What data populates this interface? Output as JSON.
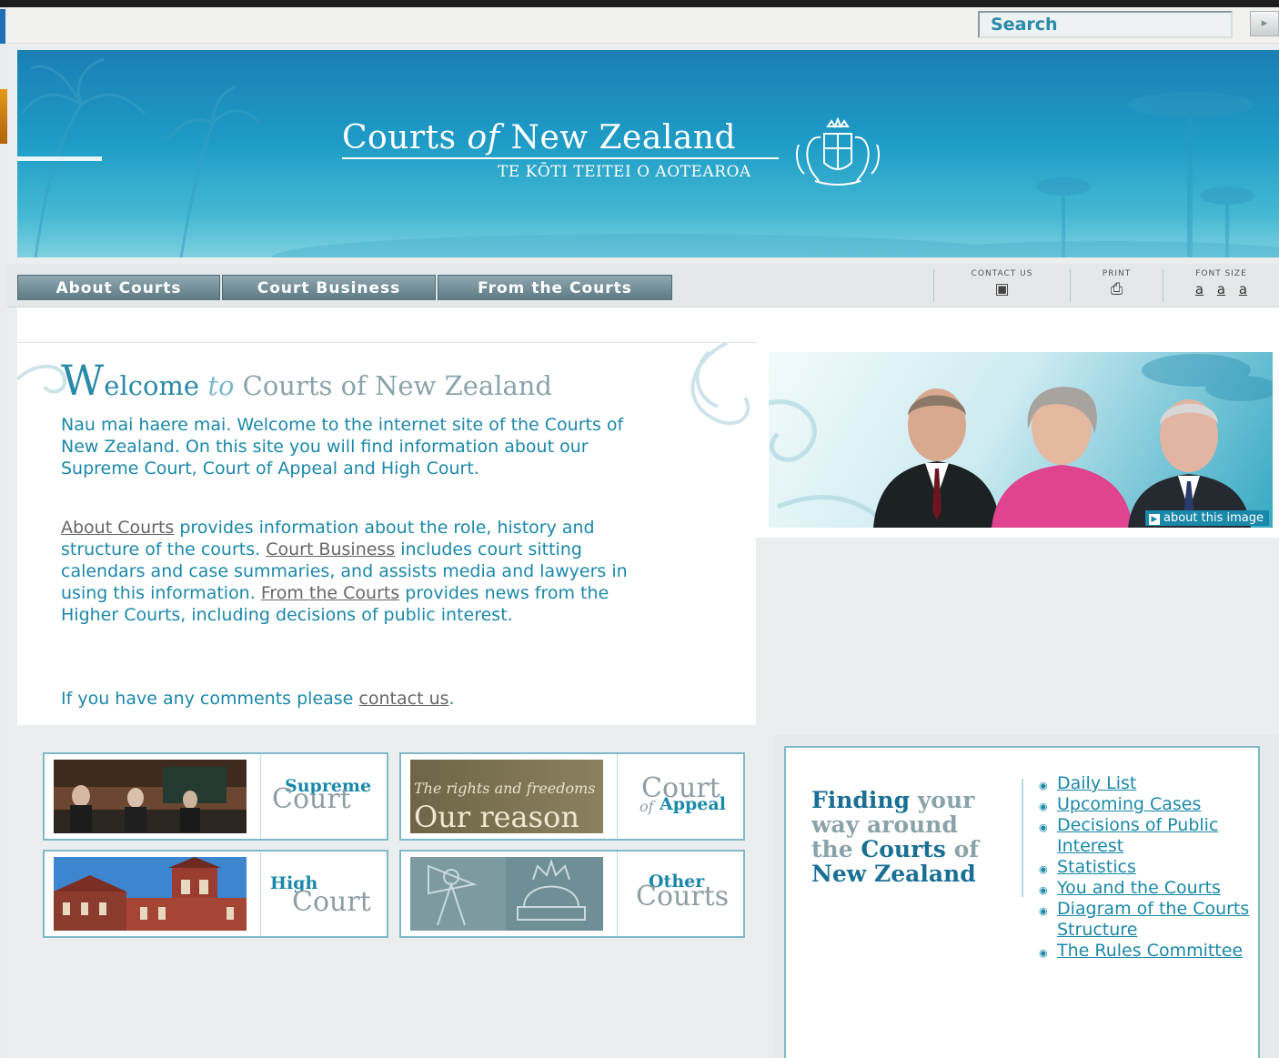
{
  "search": {
    "placeholder": "Search",
    "button_glyph": "▸"
  },
  "banner": {
    "title_part1": "Courts",
    "title_of": "of",
    "title_part2": "New Zealand",
    "subtitle": "TE KŌTI TEITEI O AOTEAROA"
  },
  "nav": {
    "tabs": [
      {
        "label": "About Courts"
      },
      {
        "label": "Court Business"
      },
      {
        "label": "From the Courts"
      }
    ]
  },
  "utilities": {
    "contact_label": "CONTACT US",
    "print_label": "PRINT",
    "font_size_label": "FONT SIZE",
    "font_sizes": [
      "a",
      "a",
      "a"
    ]
  },
  "welcome": {
    "title_w": "W",
    "title_elcome": "elcome",
    "title_to": "to",
    "title_rest": "Courts of New Zealand",
    "p1": "Nau mai haere mai. Welcome to the internet site of the Courts of New Zealand. On this site you will find information about our Supreme Court, Court of Appeal and High Court.",
    "p2_link1": "About Courts",
    "p2_text1": " provides information about the role, history and structure of the courts. ",
    "p2_link2": "Court Business",
    "p2_text2": " includes court sitting calendars and case summaries, and assists media and lawyers in using this information. ",
    "p2_link3": "From the Courts",
    "p2_text3": " provides news from the Higher Courts, including decisions of public interest.",
    "p3_text": "If you have any comments please ",
    "p3_link": "contact us",
    "p3_end": "."
  },
  "photo": {
    "about_image_label": "about this image"
  },
  "courts": [
    {
      "line1": "Supreme",
      "line2": "Court"
    },
    {
      "line1": "Court",
      "line2_small": "of",
      "line2": "Appeal"
    },
    {
      "line1": "High",
      "line2": "Court"
    },
    {
      "line1": "Other",
      "line2": "Courts"
    }
  ],
  "appeal_thumb": {
    "line1": "The rights and freedoms",
    "line2": "Our reason"
  },
  "finding": {
    "w1": "Finding",
    "w2": " your way around the ",
    "w3": "Courts",
    "w4": " of ",
    "w5": "New Zealand",
    "links": [
      "Daily List",
      "Upcoming Cases",
      "Decisions of Public Interest",
      "Statistics",
      "You and the Courts",
      "Diagram of the Courts Structure",
      "The Rules Committee"
    ]
  },
  "colors": {
    "accent": "#1a88a9",
    "banner": "#1e9cc6",
    "tab": "#5c7983"
  }
}
